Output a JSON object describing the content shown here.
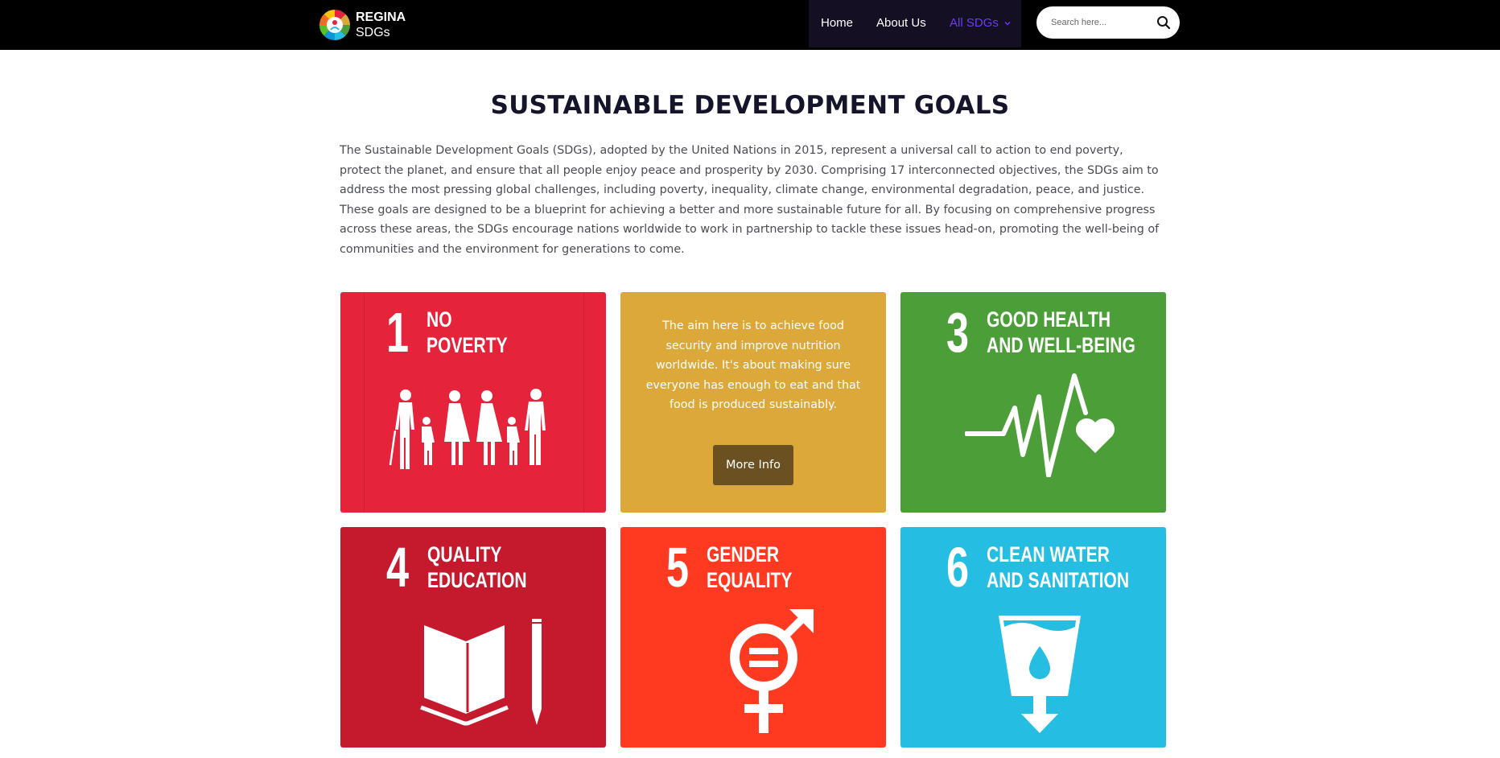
{
  "header": {
    "logo_line1": "REGINA",
    "logo_line2": "SDGs",
    "nav": {
      "home": "Home",
      "about": "About Us",
      "all_sdgs": "All SDGs"
    },
    "search": {
      "placeholder": "Search here..."
    }
  },
  "main": {
    "title": "SUSTAINABLE DEVELOPMENT GOALS",
    "intro": " The Sustainable Development Goals (SDGs), adopted by the United Nations in 2015, represent a universal call to action to end poverty, protect the planet, and ensure that all people enjoy peace and prosperity by 2030. Comprising 17 interconnected objectives, the SDGs aim to address the most pressing global challenges, including poverty, inequality, climate change, environmental degradation, peace, and justice. These goals are designed to be a blueprint for achieving a better and more sustainable future for all. By focusing on comprehensive progress across these areas, the SDGs encourage nations worldwide to work in partnership to tackle these issues head-on, promoting the well-being of communities and the environment for generations to come."
  },
  "cards": [
    {
      "number": "1",
      "title_l1": "NO",
      "title_l2": "POVERTY",
      "icon": "family-icon",
      "color": "#e5243b"
    },
    {
      "hover_text": "The aim here is to achieve food security and improve nutrition worldwide. It's about making sure everyone has enough to eat and that food is produced sustainably.",
      "button": "More Info",
      "color": "#dda83a",
      "button_color": "#6b5121"
    },
    {
      "number": "3",
      "title_l1": "GOOD HEALTH",
      "title_l2": "AND WELL-BEING",
      "icon": "heartbeat-icon",
      "color": "#4c9f38"
    },
    {
      "number": "4",
      "title_l1": "QUALITY",
      "title_l2": "EDUCATION",
      "icon": "book-pencil-icon",
      "color": "#c5192d"
    },
    {
      "number": "5",
      "title_l1": "GENDER",
      "title_l2": "EQUALITY",
      "icon": "gender-equality-icon",
      "color": "#ff3a21"
    },
    {
      "number": "6",
      "title_l1": "CLEAN WATER",
      "title_l2": "AND SANITATION",
      "icon": "water-glass-icon",
      "color": "#26bde2"
    }
  ],
  "colors": {
    "navbar": "#000000",
    "nav_active": "#6a3cf5",
    "title": "#15142b",
    "body_text": "#4b4b55"
  }
}
